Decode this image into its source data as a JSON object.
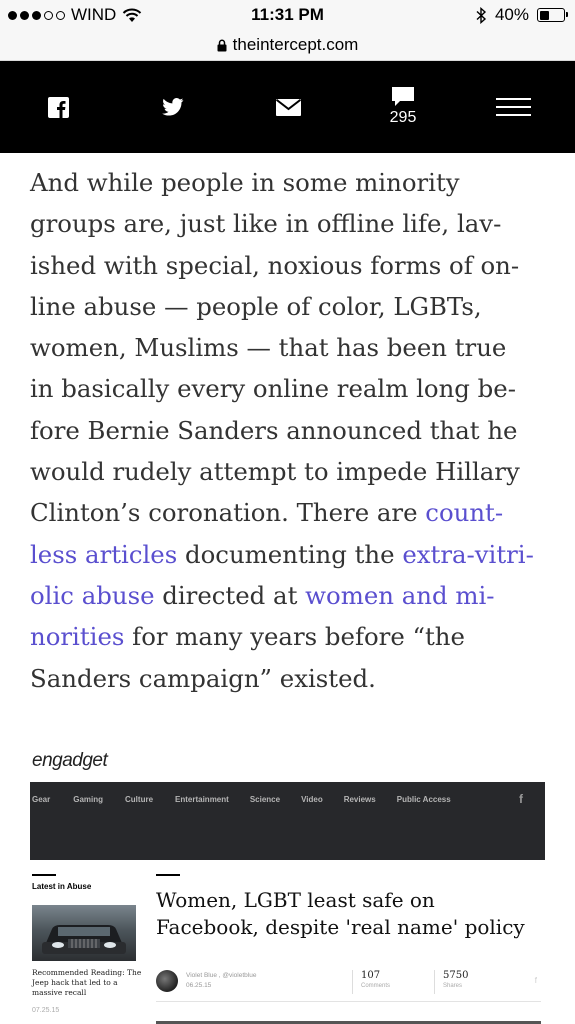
{
  "status_bar": {
    "carrier": "WIND",
    "time": "11:31 PM",
    "battery": "40%",
    "battery_level": 0.4,
    "signal_bars_filled": 3,
    "signal_bars_total": 5
  },
  "browser": {
    "url": "theintercept.com"
  },
  "toolbar": {
    "icons": [
      "facebook-icon",
      "twitter-icon",
      "email-icon",
      "comments-icon",
      "menu-icon"
    ],
    "comment_count": "295"
  },
  "article": {
    "line_1": "And while people in some minority",
    "line_2": "groups are, just like in offline life, lav-",
    "line_3": "ished with special, noxious forms of on-",
    "line_4": "line abuse — people of color, LGBTs,",
    "line_5": "women, Muslims — that has been true",
    "line_6": "in basically every online realm long be-",
    "line_7": "fore Bernie Sanders announced that he",
    "line_8": "would rudely attempt to impede Hillary",
    "line_9_text": "Clinton’s coronation. There are ",
    "link_1a": "count-",
    "link_1b": "less articles",
    "line_10_text": " documenting the ",
    "link_2a": "extra-vitri-",
    "link_2b": "olic abuse",
    "line_11_text": " directed at ",
    "link_3a": "women and mi-",
    "link_3b": "norities",
    "line_12_text": " for many years before “the",
    "line_13": "Sanders campaign” existed.",
    "link_color": "#5a4fcf"
  },
  "embed": {
    "logo": "engadget",
    "nav": [
      "Gear",
      "Gaming",
      "Culture",
      "Entertainment",
      "Science",
      "Video",
      "Reviews",
      "Public Access"
    ],
    "nav_social": "f",
    "latest_label": "Latest in Abuse",
    "recommended": "Recommended Reading: The Jeep hack that led to a massive recall",
    "recommended_date": "07.25.15",
    "headline": "Women, LGBT least safe on Facebook, despite 'real name' policy",
    "author": "Violet Blue , @violetblue",
    "date": "06.25.15",
    "comments_value": "107",
    "comments_label": "Comments",
    "shares_value": "5750",
    "shares_label": "Shares",
    "share_icon": "f"
  }
}
